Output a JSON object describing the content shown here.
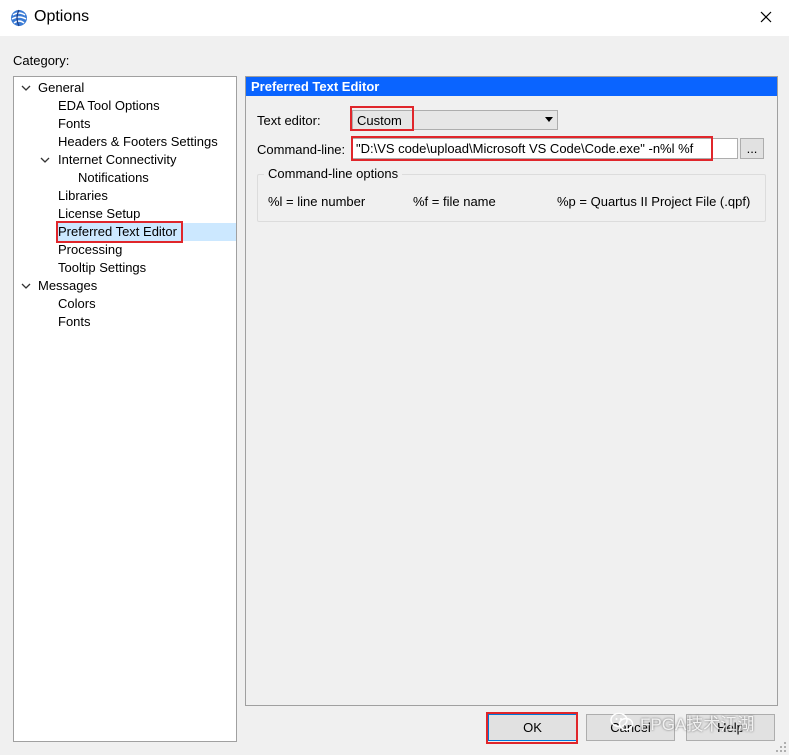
{
  "window": {
    "title": "Options",
    "app_icon": "quartus-globe-icon",
    "close_icon": "close-icon"
  },
  "category": {
    "label": "Category:",
    "tree": [
      {
        "label": "General",
        "expanded": true,
        "toggle_icon": "chevron-down-icon"
      },
      {
        "label": "EDA Tool Options"
      },
      {
        "label": "Fonts"
      },
      {
        "label": "Headers & Footers Settings"
      },
      {
        "label": "Internet Connectivity",
        "expanded": true,
        "toggle_icon": "chevron-down-icon"
      },
      {
        "label": "Notifications"
      },
      {
        "label": "Libraries"
      },
      {
        "label": "License Setup"
      },
      {
        "label": "Preferred Text Editor",
        "selected": true
      },
      {
        "label": "Processing"
      },
      {
        "label": "Tooltip Settings"
      },
      {
        "label": "Messages",
        "expanded": true,
        "toggle_icon": "chevron-down-icon"
      },
      {
        "label": "Colors"
      },
      {
        "label": "Fonts"
      }
    ]
  },
  "panel": {
    "header": "Preferred Text Editor",
    "text_editor_label": "Text editor:",
    "text_editor_value": "Custom",
    "command_line_label": "Command-line:",
    "command_line_value": "\"D:\\VS code\\upload\\Microsoft VS Code\\Code.exe\"  -n%l %f",
    "browse_label": "...",
    "options_group": {
      "title": "Command-line options",
      "items": [
        "%l = line number",
        "%f = file name",
        "%p = Quartus II Project File (.qpf)"
      ]
    }
  },
  "buttons": {
    "ok": "OK",
    "cancel": "Cancel",
    "help": "Help"
  },
  "watermark": {
    "text": "FPGA技术江湖",
    "icon": "wechat-icon"
  },
  "colors": {
    "header_bg": "#0a64ff",
    "highlight_box": "#e0262b",
    "selection": "#cce8ff"
  }
}
